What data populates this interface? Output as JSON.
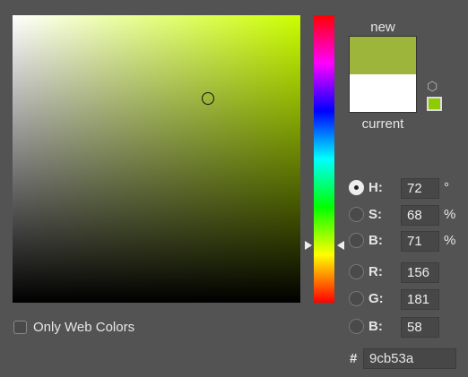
{
  "picker": {
    "hue_deg": 72,
    "marker_saturation_pct": 68,
    "marker_brightness_pct": 71
  },
  "swatches": {
    "new_label": "new",
    "current_label": "current",
    "new_color": "#9cb53a",
    "current_color": "#ffffff",
    "web_safe_color": "#99cc00",
    "cube_icon": "out-of-gamut-cube-icon"
  },
  "fields": [
    {
      "label": "H:",
      "value": "72",
      "unit": "°",
      "selected": true
    },
    {
      "label": "S:",
      "value": "68",
      "unit": "%"
    },
    {
      "label": "B:",
      "value": "71",
      "unit": "%"
    },
    {
      "label": "R:",
      "value": "156",
      "unit": ""
    },
    {
      "label": "G:",
      "value": "181",
      "unit": ""
    },
    {
      "label": "B:",
      "value": "58",
      "unit": ""
    }
  ],
  "hex": {
    "prefix": "#",
    "value": "9cb53a"
  },
  "web_only": {
    "label": "Only Web Colors",
    "checked": false
  }
}
